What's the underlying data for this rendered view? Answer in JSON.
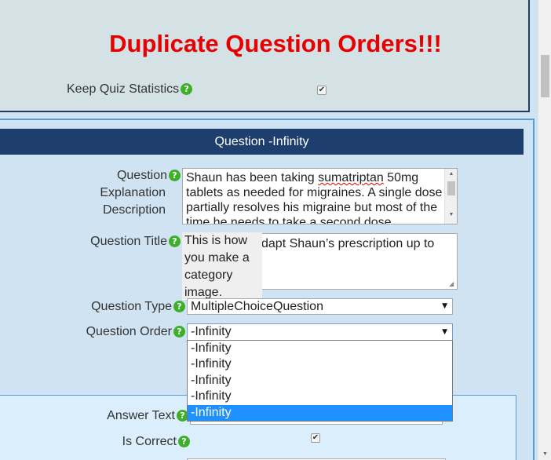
{
  "header": {
    "warning": "Duplicate Question Orders!!!",
    "keep_stats_label": "Keep Quiz Statistics",
    "keep_stats_checked": true
  },
  "question": {
    "section_title": "Question -Infinity",
    "explanation_label_1": "Question",
    "explanation_label_2": "Explanation",
    "explanation_label_3": "Description",
    "explanation_text_1": "Shaun has been taking ",
    "explanation_text_misspelled": "sumatriptan",
    "explanation_text_2": " 50mg tablets as needed for migraines. A single dose partially resolves his migraine but most of the time he needs to take a second dose",
    "title_label": "Question Title",
    "title_text": "dapt Shaun’s prescription up to",
    "tooltip_text": "This is how you make a category image.",
    "type_label": "Question Type",
    "type_value": "MultipleChoiceQuestion",
    "order_label": "Question Order",
    "order_value": "-Infinity",
    "order_options": [
      "-Infinity",
      "-Infinity",
      "-Infinity",
      "-Infinity",
      "-Infinity"
    ],
    "selected_option_index": 4
  },
  "answer": {
    "text_label": "Answer Text",
    "correct_label": "Is Correct",
    "correct_checked": true
  },
  "icons": {
    "help": "help-icon",
    "check": "checkmark-icon",
    "dropdown": "chevron-down-icon"
  },
  "colors": {
    "warning": "#e60000",
    "header_bg": "#1e3f6e",
    "help_icon": "#3fae2a",
    "selected_option": "#1e90ff"
  }
}
